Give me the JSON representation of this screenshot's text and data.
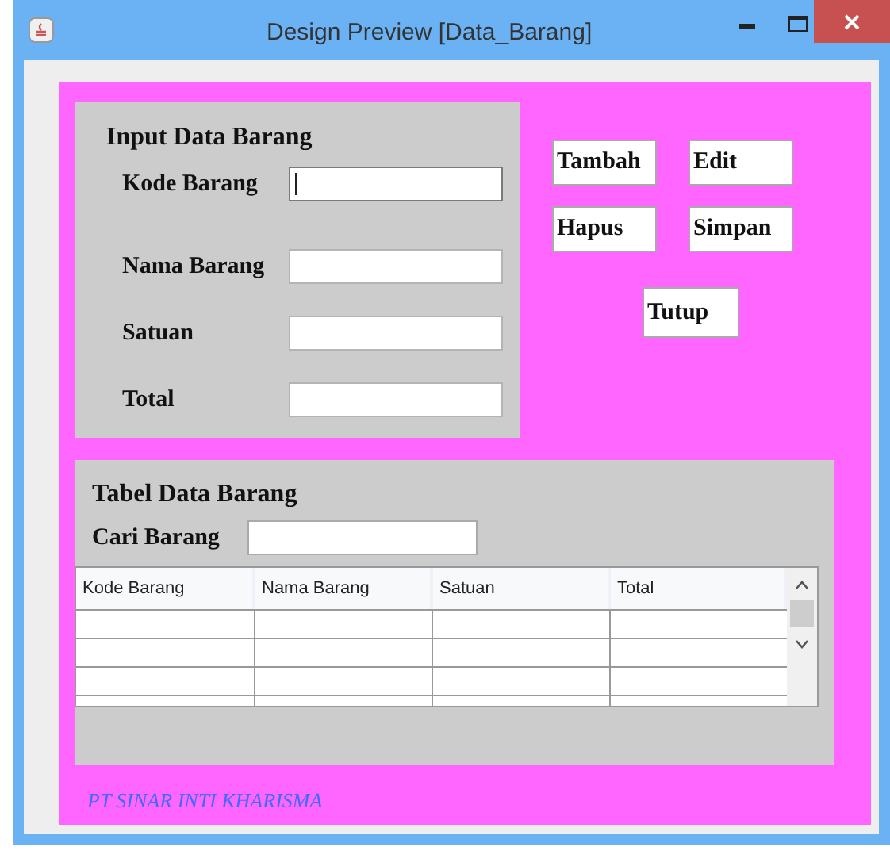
{
  "window": {
    "title": "Design Preview [Data_Barang]"
  },
  "input_panel": {
    "title": "Input Data Barang",
    "fields": [
      {
        "label": "Kode Barang",
        "focused": true
      },
      {
        "label": "Nama Barang",
        "focused": false
      },
      {
        "label": "Satuan",
        "focused": false
      },
      {
        "label": "Total",
        "focused": false
      }
    ]
  },
  "buttons": [
    "Tambah",
    "Edit",
    "Hapus",
    "Simpan",
    "Tutup"
  ],
  "table_panel": {
    "title": "Tabel Data Barang",
    "search": {
      "label": "Cari Barang"
    },
    "table": {
      "columns": [
        "Kode Barang",
        "Nama Barang",
        "Satuan",
        "Total"
      ]
    }
  },
  "footer": "PT SINAR INTI KHARISMA"
}
